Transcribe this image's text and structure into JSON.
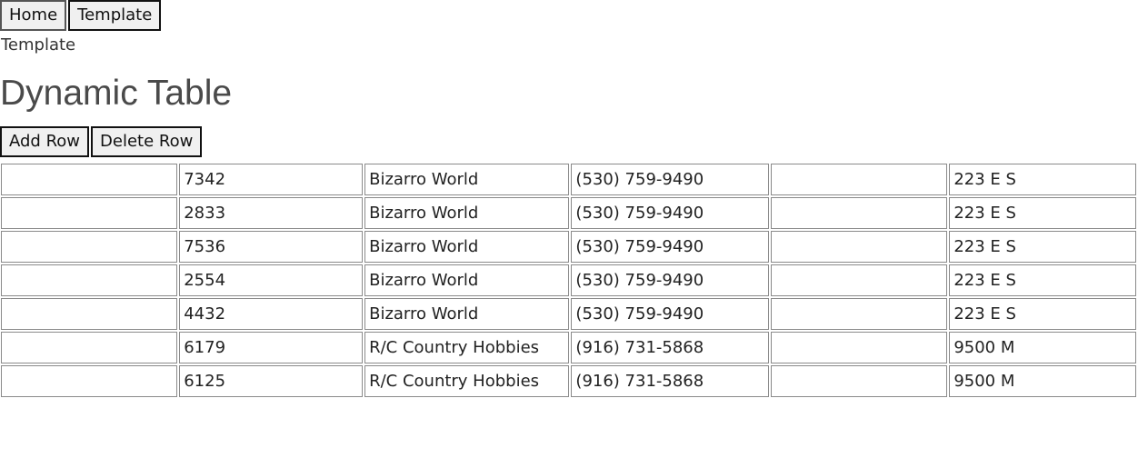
{
  "nav": {
    "home_label": "Home",
    "template_label": "Template"
  },
  "breadcrumb": "Template",
  "page_title": "Dynamic Table",
  "actions": {
    "add_row_label": "Add Row",
    "delete_row_label": "Delete Row"
  },
  "table": {
    "rows": [
      {
        "c1": "",
        "id": "7342",
        "name": "Bizarro World",
        "phone": "(530) 759-9490",
        "c5": "",
        "address": "223 E S"
      },
      {
        "c1": "",
        "id": "2833",
        "name": "Bizarro World",
        "phone": "(530) 759-9490",
        "c5": "",
        "address": "223 E S"
      },
      {
        "c1": "",
        "id": "7536",
        "name": "Bizarro World",
        "phone": "(530) 759-9490",
        "c5": "",
        "address": "223 E S"
      },
      {
        "c1": "",
        "id": "2554",
        "name": "Bizarro World",
        "phone": "(530) 759-9490",
        "c5": "",
        "address": "223 E S"
      },
      {
        "c1": "",
        "id": "4432",
        "name": "Bizarro World",
        "phone": "(530) 759-9490",
        "c5": "",
        "address": "223 E S"
      },
      {
        "c1": "",
        "id": "6179",
        "name": "R/C Country Hobbies",
        "phone": "(916) 731-5868",
        "c5": "",
        "address": "9500 M"
      },
      {
        "c1": "",
        "id": "6125",
        "name": "R/C Country Hobbies",
        "phone": "(916) 731-5868",
        "c5": "",
        "address": "9500 M"
      }
    ]
  }
}
